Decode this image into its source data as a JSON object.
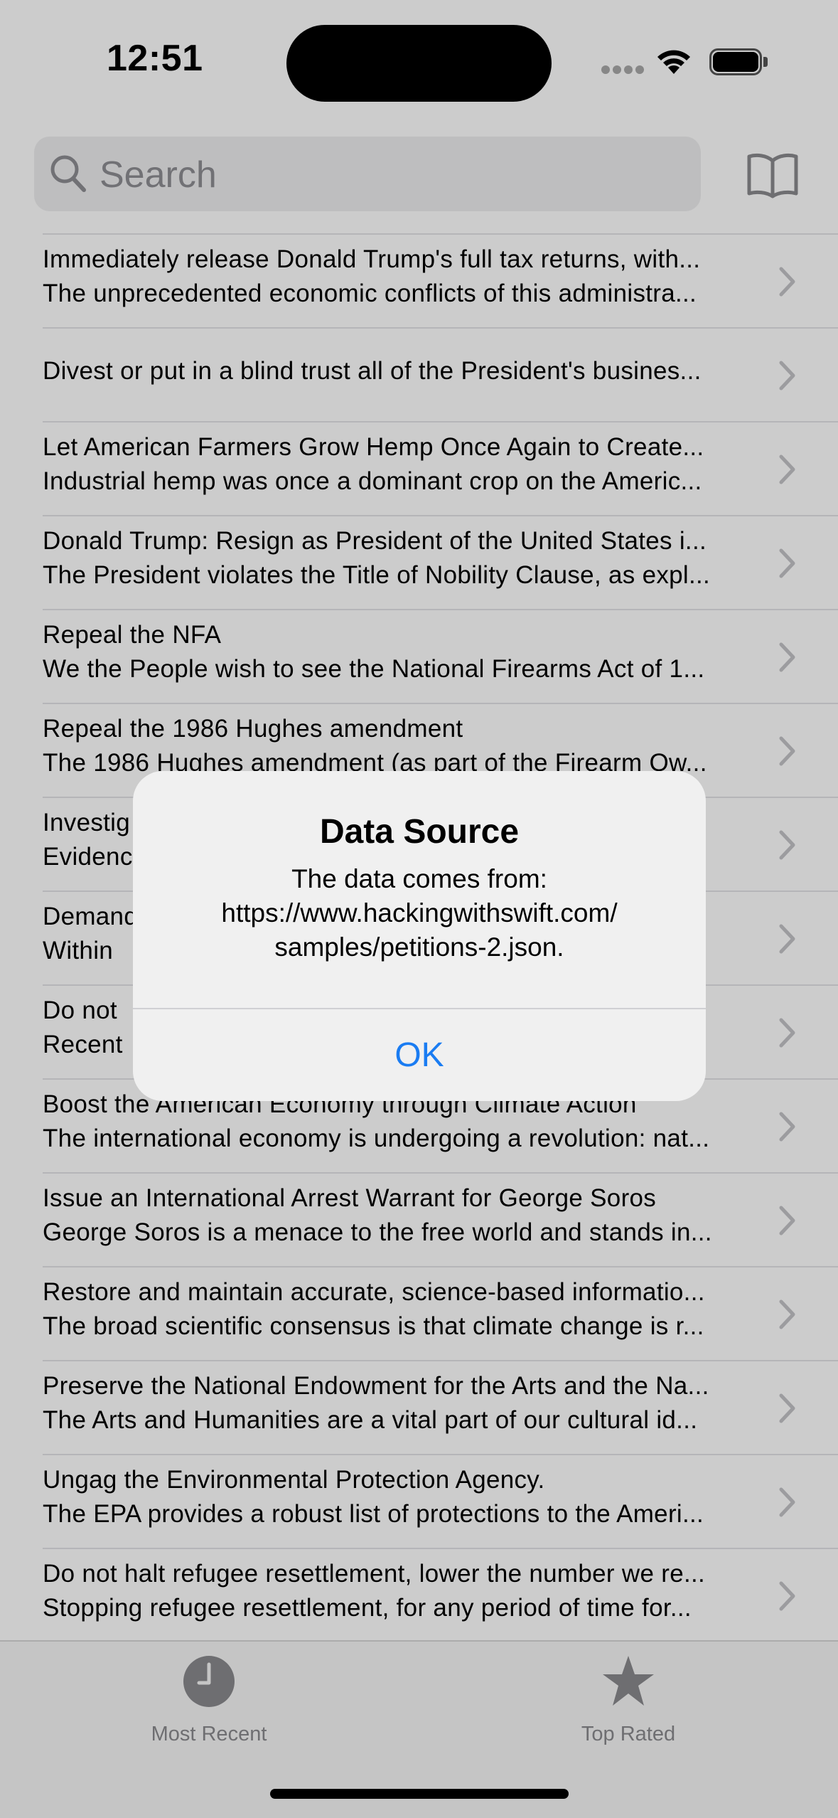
{
  "status_bar": {
    "time": "12:51"
  },
  "search": {
    "placeholder": "Search"
  },
  "petitions": [
    {
      "title": "Immediately release Donald Trump's full tax returns, with...",
      "body": "The unprecedented economic conflicts of this administra..."
    },
    {
      "title": "Divest or put in a blind trust all of the President's busines...",
      "body": ""
    },
    {
      "title": "Let American Farmers Grow Hemp Once Again to Create...",
      "body": "Industrial hemp was once a dominant crop on the Americ..."
    },
    {
      "title": "Donald Trump:  Resign as President of the United States i...",
      "body": "The President violates the Title of Nobility Clause, as expl..."
    },
    {
      "title": "Repeal the NFA",
      "body": "We the People wish to see the National Firearms Act of 1..."
    },
    {
      "title": "Repeal the 1986 Hughes amendment",
      "body": "The 1986 Hughes amendment (as part of the Firearm Ow..."
    },
    {
      "title": "Investig",
      "body": "Evidenc"
    },
    {
      "title": "Demand",
      "body": "Within"
    },
    {
      "title": "Do not",
      "body": "Recent"
    },
    {
      "title": "Boost the American Economy through Climate Action",
      "body": "The international economy is undergoing a revolution: nat..."
    },
    {
      "title": "Issue an International Arrest Warrant for George Soros",
      "body": "George Soros is a menace to the free world and stands in..."
    },
    {
      "title": "Restore and maintain accurate, science-based informatio...",
      "body": "The broad scientific consensus is that climate change is r..."
    },
    {
      "title": "Preserve the National Endowment for the Arts and the Na...",
      "body": "The Arts and Humanities  are a vital part of our cultural id..."
    },
    {
      "title": "Ungag the Environmental Protection Agency.",
      "body": "The EPA provides a robust list of protections to the Ameri..."
    },
    {
      "title": "Do not halt refugee resettlement, lower the number we re...",
      "body": "Stopping refugee resettlement, for any period of time for..."
    }
  ],
  "tab_bar": {
    "tabs": [
      {
        "label": "Most Recent",
        "icon": "clock-icon"
      },
      {
        "label": "Top Rated",
        "icon": "star-icon"
      }
    ]
  },
  "alert": {
    "title": "Data Source",
    "message_lines": [
      "The data comes from:",
      "https://www.hackingwithswift.com/",
      "samples/petitions-2.json."
    ],
    "ok_label": "OK"
  },
  "colors": {
    "accent": "#1a7cf2",
    "separator": "#e3e3e6",
    "secondary_text": "#8a8a8e"
  }
}
